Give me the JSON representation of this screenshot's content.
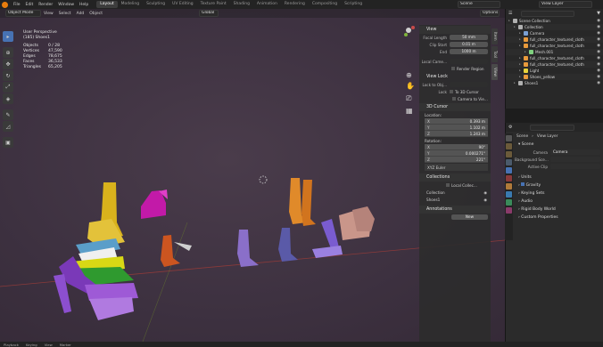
{
  "menu": [
    "File",
    "Edit",
    "Render",
    "Window",
    "Help"
  ],
  "workspaces": [
    {
      "label": "Layout",
      "active": true
    },
    {
      "label": "Modeling",
      "active": false
    },
    {
      "label": "Sculpting",
      "active": false
    },
    {
      "label": "UV Editing",
      "active": false
    },
    {
      "label": "Texture Paint",
      "active": false
    },
    {
      "label": "Shading",
      "active": false
    },
    {
      "label": "Animation",
      "active": false
    },
    {
      "label": "Rendering",
      "active": false
    },
    {
      "label": "Compositing",
      "active": false
    },
    {
      "label": "Scripting",
      "active": false
    }
  ],
  "top_right": {
    "scene": "Scene",
    "view_layer": "View Layer"
  },
  "viewport": {
    "mode": "Object Mode",
    "menus": [
      "View",
      "Select",
      "Add",
      "Object"
    ],
    "transform": "Global",
    "options": "Options",
    "overlay_title": "User Perspective",
    "overlay_subtitle": "(185) Shoes1",
    "stats": [
      {
        "label": "Objects",
        "value": "0 / 28"
      },
      {
        "label": "Vertices",
        "value": "47,590"
      },
      {
        "label": "Edges",
        "value": "78,675"
      },
      {
        "label": "Faces",
        "value": "36,533"
      },
      {
        "label": "Triangles",
        "value": "65,205"
      }
    ]
  },
  "npanel": {
    "tabs": [
      "Item",
      "Tool",
      "View"
    ],
    "view_header": "View",
    "focal_label": "Focal Length",
    "focal_value": "50 mm",
    "clip_start_label": "Clip Start",
    "clip_start_value": "0.01 m",
    "clip_end_label": "End",
    "clip_end_value": "1000 m",
    "local_camera_label": "Local Came...",
    "render_region_label": "Render Region",
    "view_lock_header": "View Lock",
    "lock_to_obj_label": "Lock to Obj...",
    "lock_label": "Lock",
    "to_3d_cursor": "To 3D Cursor",
    "camera_to_view": "Camera to Vie...",
    "cursor_header": "3D Cursor",
    "location_label": "Location:",
    "loc": [
      {
        "axis": "X",
        "value": "0.393 m"
      },
      {
        "axis": "Y",
        "value": "1.102 m"
      },
      {
        "axis": "Z",
        "value": "1.243 m"
      }
    ],
    "rotation_label": "Rotation:",
    "rot": [
      {
        "axis": "X",
        "value": "90°"
      },
      {
        "axis": "Y",
        "value": "0.000271°"
      },
      {
        "axis": "Z",
        "value": "221°"
      }
    ],
    "euler": "XYZ Euler",
    "collections_header": "Collections",
    "local_collections": "Local Collec...",
    "collection_rows": [
      "Collection",
      "Shoes1"
    ],
    "annotations_header": "Annotations",
    "new_label": "New"
  },
  "outliner": {
    "search_placeholder": "",
    "rows": [
      {
        "label": "Scene Collection",
        "indent": 0,
        "color": "#b0b0b0"
      },
      {
        "label": "Collection",
        "indent": 1,
        "color": "#b0b0b0"
      },
      {
        "label": "Camera",
        "indent": 2,
        "color": "#7aa0d4"
      },
      {
        "label": "full_character_textured_cloth",
        "indent": 2,
        "color": "#e89a3c"
      },
      {
        "label": "full_character_textured_cloth",
        "indent": 2,
        "color": "#e89a3c"
      },
      {
        "label": "Mesh.001",
        "indent": 3,
        "color": "#7fd17f"
      },
      {
        "label": "full_character_textured_cloth",
        "indent": 2,
        "color": "#e89a3c"
      },
      {
        "label": "full_character_textured_cloth",
        "indent": 2,
        "color": "#e89a3c"
      },
      {
        "label": "Light",
        "indent": 2,
        "color": "#e8d23c"
      },
      {
        "label": "Shoes_yellow",
        "indent": 2,
        "color": "#e89a3c"
      },
      {
        "label": "Shoes1",
        "indent": 1,
        "color": "#b0b0b0"
      }
    ]
  },
  "properties": {
    "breadcrumb_scene": "Scene",
    "breadcrumb_layer": "View Layer",
    "scene_header": "Scene",
    "camera_label": "Camera",
    "camera_value": "Camera",
    "bg_label": "Background Sce...",
    "clip_label": "Active Clip",
    "sections": [
      "Units",
      "Gravity",
      "Keying Sets",
      "Audio",
      "Rigid Body World",
      "Custom Properties"
    ]
  },
  "status": [
    "Playback",
    "Keying",
    "View",
    "Marker"
  ],
  "colors": {
    "accent": "#4772b3",
    "active_ws": "#3d3d3d",
    "grid_x": "#8a3a3a",
    "grid_y": "#6f8a2a"
  }
}
